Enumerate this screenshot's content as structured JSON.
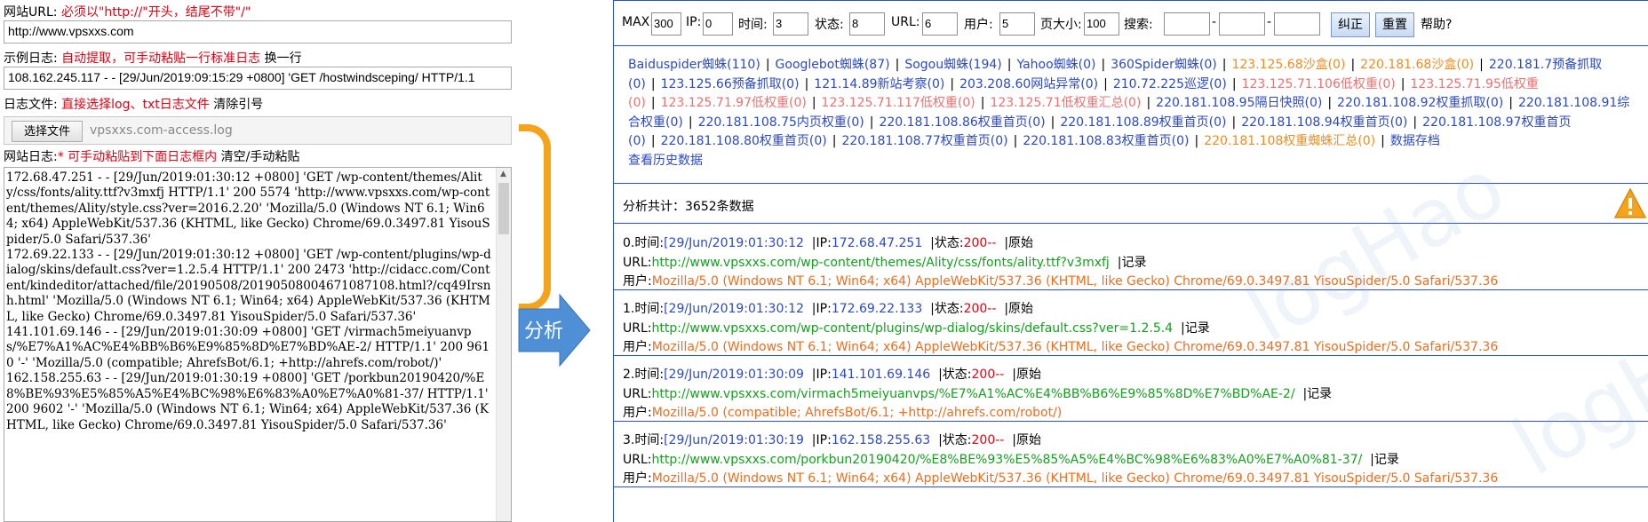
{
  "left": {
    "url_label": "网站URL:",
    "url_hint": "必须以\"http://\"开头，结尾不带\"/\"",
    "url_value": "http://www.vpsxxs.com",
    "sample_label": "示例日志:",
    "sample_hint": "自动提取，可手动粘贴一行标准日志",
    "sample_action": "换一行",
    "sample_value": "108.162.245.117 - - [29/Jun/2019:09:15:29 +0800] 'GET /hostwindsceping/ HTTP/1.1",
    "file_label": "日志文件:",
    "file_hint": "直接选择log、txt日志文件",
    "file_action": "清除引号",
    "choose_button": "选择文件",
    "file_name": "vpsxxs.com-access.log",
    "log_label": "网站日志:",
    "log_required": "*",
    "log_hint": "可手动粘贴到下面日志框内",
    "log_action": "清空/手动粘贴",
    "log_text": "172.68.47.251 - - [29/Jun/2019:01:30:12 +0800] 'GET /wp-content/themes/Ality/css/fonts/ality.ttf?v3mxfj HTTP/1.1' 200 5574 'http://www.vpsxxs.com/wp-content/themes/Ality/style.css?ver=2016.2.20' 'Mozilla/5.0 (Windows NT 6.1; Win64; x64) AppleWebKit/537.36 (KHTML, like Gecko) Chrome/69.0.3497.81 YisouSpider/5.0 Safari/537.36'\n172.69.22.133 - - [29/Jun/2019:01:30:12 +0800] 'GET /wp-content/plugins/wp-dialog/skins/default.css?ver=1.2.5.4 HTTP/1.1' 200 2473 'http://cidacc.com/Content/kindeditor/attached/file/20190508/20190508004671087108.html?/cq49Irsnh.html' 'Mozilla/5.0 (Windows NT 6.1; Win64; x64) AppleWebKit/537.36 (KHTML, like Gecko) Chrome/69.0.3497.81 YisouSpider/5.0 Safari/537.36'\n141.101.69.146 - - [29/Jun/2019:01:30:09 +0800] 'GET /virmach5meiyuanvps/%E7%A1%AC%E4%BB%B6%E9%85%8D%E7%BD%AE-2/ HTTP/1.1' 200 9610 '-' 'Mozilla/5.0 (compatible; AhrefsBot/6.1; +http://ahrefs.com/robot/)'\n162.158.255.63 - - [29/Jun/2019:01:30:19 +0800] 'GET /porkbun20190420/%E8%BE%93%E5%85%A5%E4%BC%98%E6%83%A0%E7%A0%81-37/ HTTP/1.1' 200 9602 '-' 'Mozilla/5.0 (Windows NT 6.1; Win64; x64) AppleWebKit/537.36 (KHTML, like Gecko) Chrome/69.0.3497.81 YisouSpider/5.0 Safari/537.36'"
  },
  "analyze_label": "分析",
  "toolbar": {
    "max_label": "MAX:",
    "max_value": "300",
    "ip_label": "IP:",
    "ip_value": "0",
    "time_label": "时间:",
    "time_value": "3",
    "status_label": "状态:",
    "status_value": "8",
    "url_label": "URL:",
    "url_value": "6",
    "user_label": "用户:",
    "user_value": "5",
    "size_label": "页大小:",
    "size_value": "100",
    "search_label": "搜索:",
    "dash": "-",
    "correct_button": "纠正",
    "reset_button": "重置",
    "help_label": "帮助?"
  },
  "links": [
    {
      "text": "Baiduspider蜘蛛(110)",
      "color": "blue"
    },
    {
      "text": "Googlebot蜘蛛(87)",
      "color": "blue"
    },
    {
      "text": "Sogou蜘蛛(194)",
      "color": "blue"
    },
    {
      "text": "Yahoo蜘蛛(0)",
      "color": "blue"
    },
    {
      "text": "360Spider蜘蛛(0)",
      "color": "blue"
    },
    {
      "text": "123.125.68沙盒(0)",
      "color": "orange"
    },
    {
      "text": "220.181.68沙盒(0)",
      "color": "orange"
    },
    {
      "text": "220.181.7预备抓取(0)",
      "color": "blue"
    },
    {
      "text": "123.125.66预备抓取(0)",
      "color": "blue"
    },
    {
      "text": "121.14.89新站考察(0)",
      "color": "blue"
    },
    {
      "text": "203.208.60网站异常(0)",
      "color": "blue"
    },
    {
      "text": "210.72.225巡逻(0)",
      "color": "blue"
    },
    {
      "text": "123.125.71.106低权重(0)",
      "color": "pink"
    },
    {
      "text": "123.125.71.95低权重(0)",
      "color": "pink"
    },
    {
      "text": "123.125.71.97低权重(0)",
      "color": "pink"
    },
    {
      "text": "123.125.71.117低权重(0)",
      "color": "pink"
    },
    {
      "text": "123.125.71低权重汇总(0)",
      "color": "pink"
    },
    {
      "text": "220.181.108.95隔日快照(0)",
      "color": "blue"
    },
    {
      "text": "220.181.108.92权重抓取(0)",
      "color": "blue"
    },
    {
      "text": "220.181.108.91综合权重(0)",
      "color": "blue"
    },
    {
      "text": "220.181.108.75内页权重(0)",
      "color": "blue"
    },
    {
      "text": "220.181.108.86权重首页(0)",
      "color": "blue"
    },
    {
      "text": "220.181.108.89权重首页(0)",
      "color": "blue"
    },
    {
      "text": "220.181.108.94权重首页(0)",
      "color": "blue"
    },
    {
      "text": "220.181.108.97权重首页(0)",
      "color": "blue"
    },
    {
      "text": "220.181.108.80权重首页(0)",
      "color": "blue"
    },
    {
      "text": "220.181.108.77权重首页(0)",
      "color": "blue"
    },
    {
      "text": "220.181.108.83权重首页(0)",
      "color": "blue"
    },
    {
      "text": "220.181.108权重蜘蛛汇总(0)",
      "color": "orange"
    },
    {
      "text": "数据存档",
      "color": "blue"
    },
    {
      "text": "查看历史数据",
      "color": "blue"
    }
  ],
  "summary": "分析共计：3652条数据",
  "labels": {
    "time": "时间:",
    "ip": "|IP:",
    "status": "|状态:",
    "original": "|原始",
    "url": "URL:",
    "record": "|记录",
    "user": "用户:"
  },
  "records": [
    {
      "index": "0.",
      "time": "[29/Jun/2019:01:30:12",
      "ip": "172.68.47.251",
      "status": "200--",
      "url": "http://www.vpsxxs.com/wp-content/themes/Ality/css/fonts/ality.ttf?v3mxfj",
      "ua": "Mozilla/5.0 (Windows NT 6.1; Win64; x64) AppleWebKit/537.36 (KHTML, like Gecko) Chrome/69.0.3497.81 YisouSpider/5.0 Safari/537.36"
    },
    {
      "index": "1.",
      "time": "[29/Jun/2019:01:30:12",
      "ip": "172.69.22.133",
      "status": "200--",
      "url": "http://www.vpsxxs.com/wp-content/plugins/wp-dialog/skins/default.css?ver=1.2.5.4",
      "ua": "Mozilla/5.0 (Windows NT 6.1; Win64; x64) AppleWebKit/537.36 (KHTML, like Gecko) Chrome/69.0.3497.81 YisouSpider/5.0 Safari/537.36"
    },
    {
      "index": "2.",
      "time": "[29/Jun/2019:01:30:09",
      "ip": "141.101.69.146",
      "status": "200--",
      "url": "http://www.vpsxxs.com/virmach5meiyuanvps/%E7%A1%AC%E4%BB%B6%E9%85%8D%E7%BD%AE-2/",
      "ua": "Mozilla/5.0 (compatible; AhrefsBot/6.1; +http://ahrefs.com/robot/)"
    },
    {
      "index": "3.",
      "time": "[29/Jun/2019:01:30:19",
      "ip": "162.158.255.63",
      "status": "200--",
      "url": "http://www.vpsxxs.com/porkbun20190420/%E8%BE%93%E5%85%A5%E4%BC%98%E6%83%A0%E7%A0%81-37/",
      "ua": "Mozilla/5.0 (Windows NT 6.1; Win64; x64) AppleWebKit/537.36 (KHTML, like Gecko) Chrome/69.0.3497.81 YisouSpider/5.0 Safari/537.36"
    }
  ],
  "colors": {
    "border": "#2b4fd4",
    "bracket": "#f5a31a",
    "arrow": "#4f8fd6"
  }
}
